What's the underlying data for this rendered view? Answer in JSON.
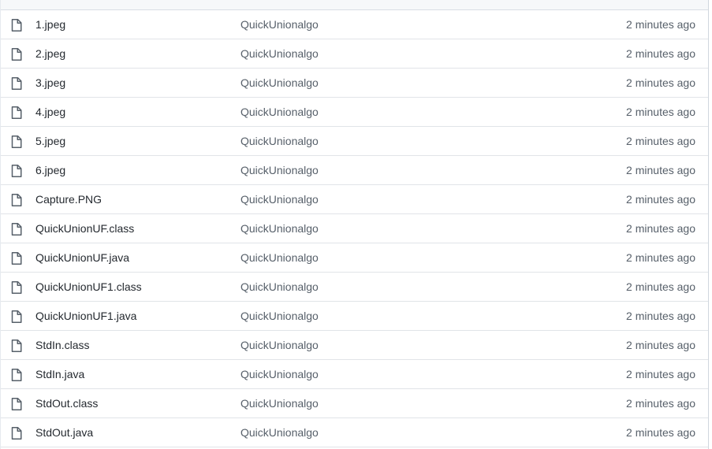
{
  "colors": {
    "icon": "#57606a",
    "border": "#e1e4e8",
    "header_bg": "#f6f8fa",
    "text": "#24292f",
    "muted": "#57606a"
  },
  "icons": {
    "file": "file-icon"
  },
  "files": [
    {
      "name": "1.jpeg",
      "commit": "QuickUnionalgo",
      "age": "2 minutes ago"
    },
    {
      "name": "2.jpeg",
      "commit": "QuickUnionalgo",
      "age": "2 minutes ago"
    },
    {
      "name": "3.jpeg",
      "commit": "QuickUnionalgo",
      "age": "2 minutes ago"
    },
    {
      "name": "4.jpeg",
      "commit": "QuickUnionalgo",
      "age": "2 minutes ago"
    },
    {
      "name": "5.jpeg",
      "commit": "QuickUnionalgo",
      "age": "2 minutes ago"
    },
    {
      "name": "6.jpeg",
      "commit": "QuickUnionalgo",
      "age": "2 minutes ago"
    },
    {
      "name": "Capture.PNG",
      "commit": "QuickUnionalgo",
      "age": "2 minutes ago"
    },
    {
      "name": "QuickUnionUF.class",
      "commit": "QuickUnionalgo",
      "age": "2 minutes ago"
    },
    {
      "name": "QuickUnionUF.java",
      "commit": "QuickUnionalgo",
      "age": "2 minutes ago"
    },
    {
      "name": "QuickUnionUF1.class",
      "commit": "QuickUnionalgo",
      "age": "2 minutes ago"
    },
    {
      "name": "QuickUnionUF1.java",
      "commit": "QuickUnionalgo",
      "age": "2 minutes ago"
    },
    {
      "name": "StdIn.class",
      "commit": "QuickUnionalgo",
      "age": "2 minutes ago"
    },
    {
      "name": "StdIn.java",
      "commit": "QuickUnionalgo",
      "age": "2 minutes ago"
    },
    {
      "name": "StdOut.class",
      "commit": "QuickUnionalgo",
      "age": "2 minutes ago"
    },
    {
      "name": "StdOut.java",
      "commit": "QuickUnionalgo",
      "age": "2 minutes ago"
    }
  ]
}
